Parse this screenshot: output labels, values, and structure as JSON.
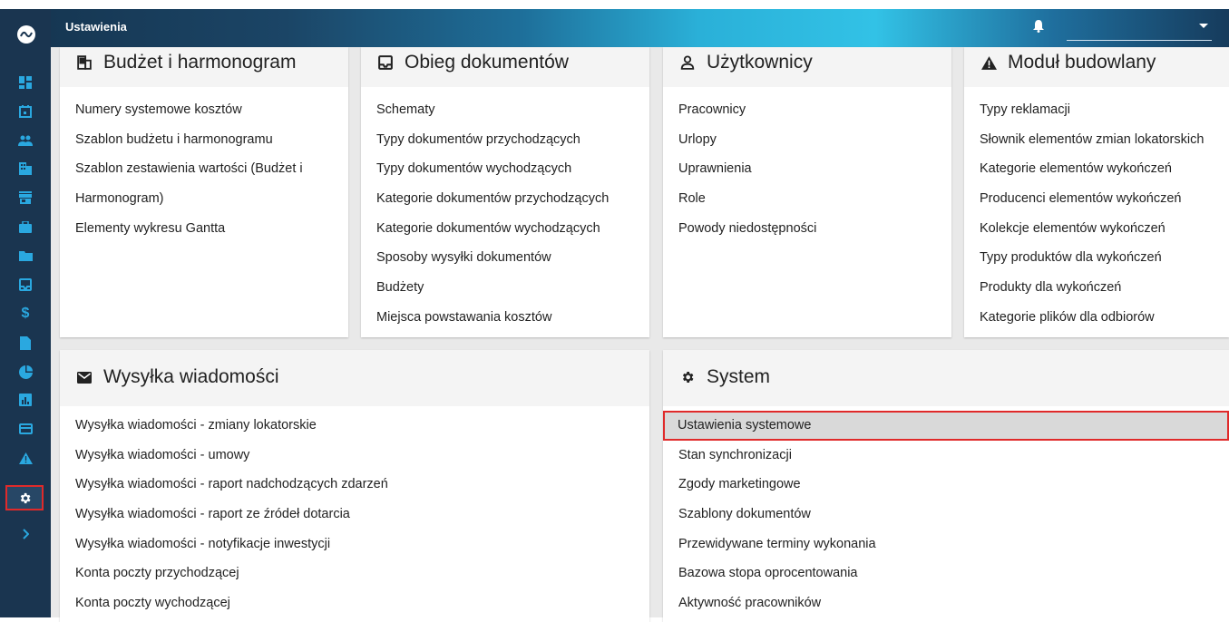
{
  "header": {
    "title": "Ustawienia"
  },
  "cards": {
    "budzet": {
      "title": "Budżet i harmonogram",
      "items": [
        "Numery systemowe kosztów",
        "Szablon budżetu i harmonogramu",
        "Szablon zestawienia wartości (Budżet i",
        "Harmonogram)",
        "Elementy wykresu Gantta"
      ]
    },
    "obieg": {
      "title": "Obieg dokumentów",
      "items": [
        "Schematy",
        "Typy dokumentów przychodzących",
        "Typy dokumentów wychodzących",
        "Kategorie dokumentów przychodzących",
        "Kategorie dokumentów wychodzących",
        "Sposoby wysyłki dokumentów",
        "Budżety",
        "Miejsca powstawania kosztów"
      ]
    },
    "uzytkownicy": {
      "title": "Użytkownicy",
      "items": [
        "Pracownicy",
        "Urlopy",
        "Uprawnienia",
        "Role",
        "Powody niedostępności"
      ]
    },
    "modul": {
      "title": "Moduł budowlany",
      "items": [
        "Typy reklamacji",
        "Słownik elementów zmian lokatorskich",
        "Kategorie elementów wykończeń",
        "Producenci elementów wykończeń",
        "Kolekcje elementów wykończeń",
        "Typy produktów dla wykończeń",
        "Produkty dla wykończeń",
        "Kategorie plików dla odbiorów"
      ]
    },
    "wysylka": {
      "title": "Wysyłka wiadomości",
      "items": [
        "Wysyłka wiadomości - zmiany lokatorskie",
        "Wysyłka wiadomości - umowy",
        "Wysyłka wiadomości - raport nadchodzących zdarzeń",
        "Wysyłka wiadomości - raport ze źródeł dotarcia",
        "Wysyłka wiadomości - notyfikacje inwestycji",
        "Konta poczty przychodzącej",
        "Konta poczty wychodzącej"
      ]
    },
    "system": {
      "title": "System",
      "items": [
        "Ustawienia systemowe",
        "Stan synchronizacji",
        "Zgody marketingowe",
        "Szablony dokumentów",
        "Przewidywane terminy wykonania",
        "Bazowa stopa oprocentowania",
        "Aktywność pracowników"
      ]
    }
  },
  "icons": {
    "sidebar": [
      "dashboard-icon",
      "calendar-icon",
      "people-icon",
      "building-icon",
      "store-icon",
      "briefcase-icon",
      "folder-icon",
      "inbox-icon",
      "dollar-icon",
      "file-icon",
      "pie-chart-icon",
      "bar-chart-icon",
      "card-icon",
      "warning-icon",
      "settings-icon",
      "chevron-right-icon"
    ]
  },
  "colors": {
    "sidebar": "#1a3550",
    "accent": "#2aa8e0",
    "highlight_border": "#e02a2a"
  }
}
